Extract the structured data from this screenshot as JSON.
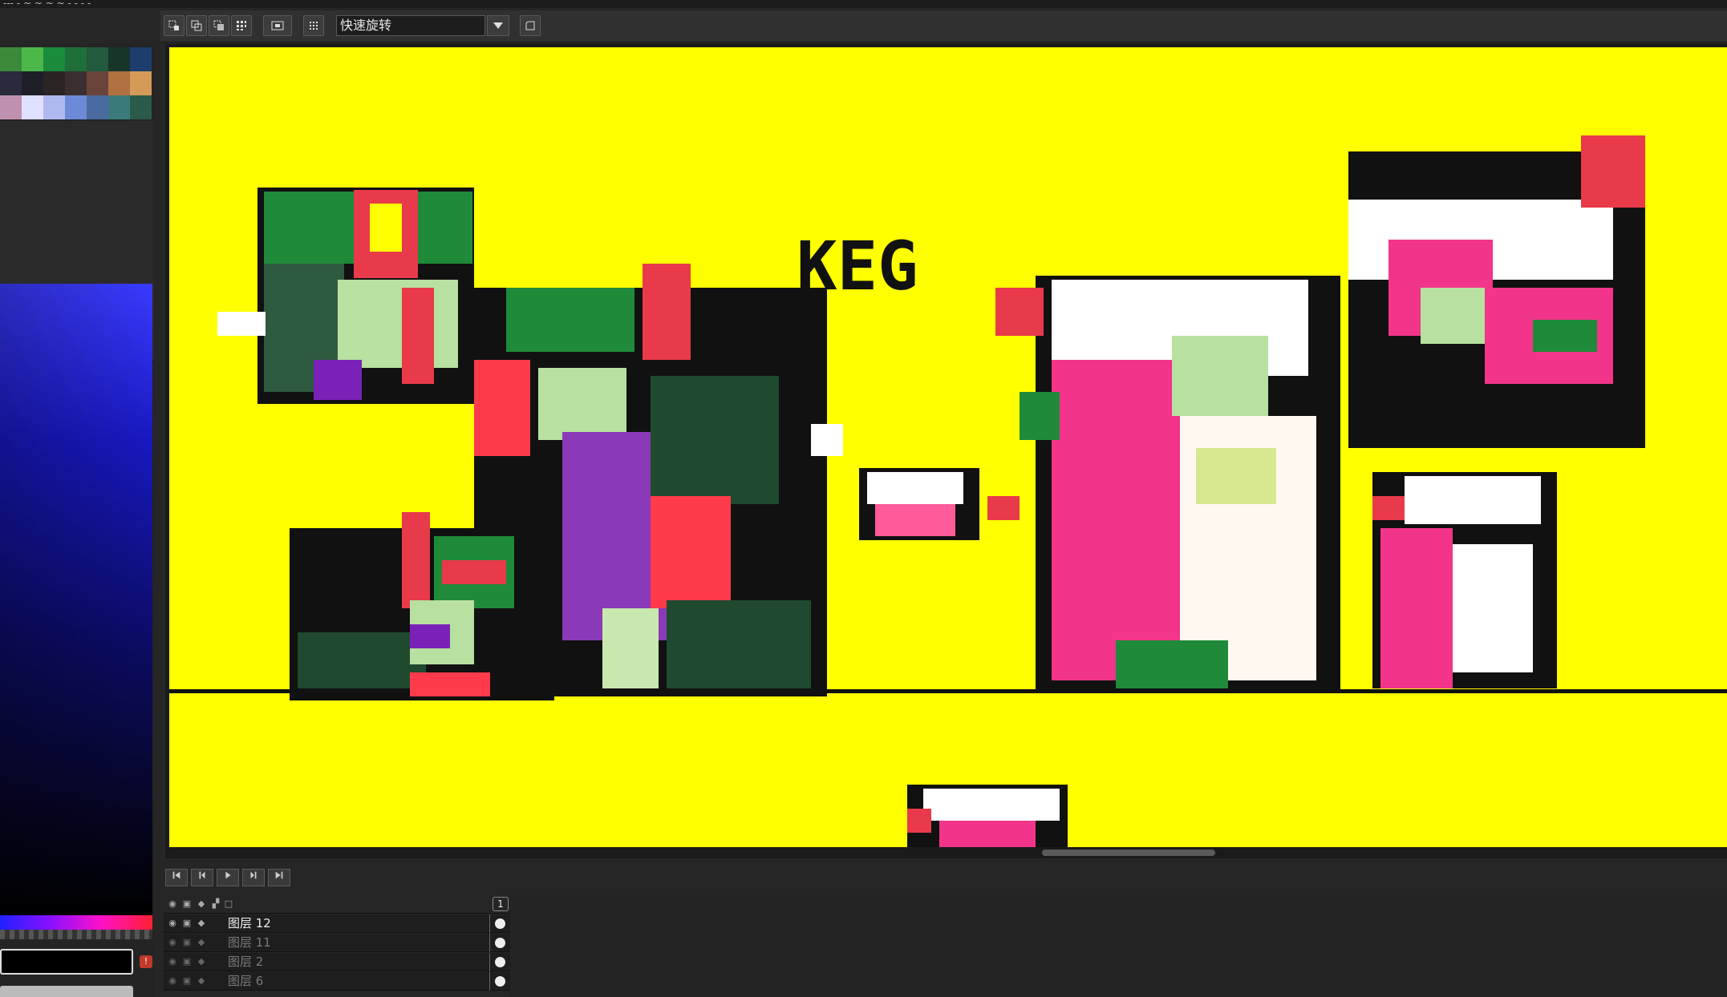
{
  "window": {
    "title_fragment": "--- - ~ ~ ~ ~ - - - -"
  },
  "toolbar": {
    "rotation_select_value": "快速旋转",
    "buttons": [
      "select-rect",
      "select-copy",
      "select-paste",
      "select-grid",
      "fit-view",
      "grid-toggle",
      "dropdown",
      "lasso"
    ]
  },
  "palette": {
    "colors": [
      "#3a8a3a",
      "#4cb84a",
      "#1a8c3c",
      "#1f6f3a",
      "#215a3c",
      "#18352a",
      "#1c3d6e",
      "#2a2a3c",
      "#1e1e28",
      "#2a2424",
      "#3a2e2e",
      "#6a443a",
      "#b07040",
      "#d69a58",
      "#c090b0",
      "#e0e0ff",
      "#b0b8f0",
      "#6c8ad8",
      "#4a6aa0",
      "#3a7a7a",
      "#2a5a4a"
    ]
  },
  "canvas": {
    "background": "#ffff00",
    "text": "KEG"
  },
  "animation": {
    "buttons": [
      "first-frame",
      "prev-frame",
      "play",
      "next-frame",
      "last-frame"
    ]
  },
  "layers": {
    "frame_number": "1",
    "rows": [
      {
        "name": "图层 12",
        "active": true
      },
      {
        "name": "图层 11",
        "active": false
      },
      {
        "name": "图层 2",
        "active": false
      },
      {
        "name": "图层 6",
        "active": false
      }
    ]
  }
}
